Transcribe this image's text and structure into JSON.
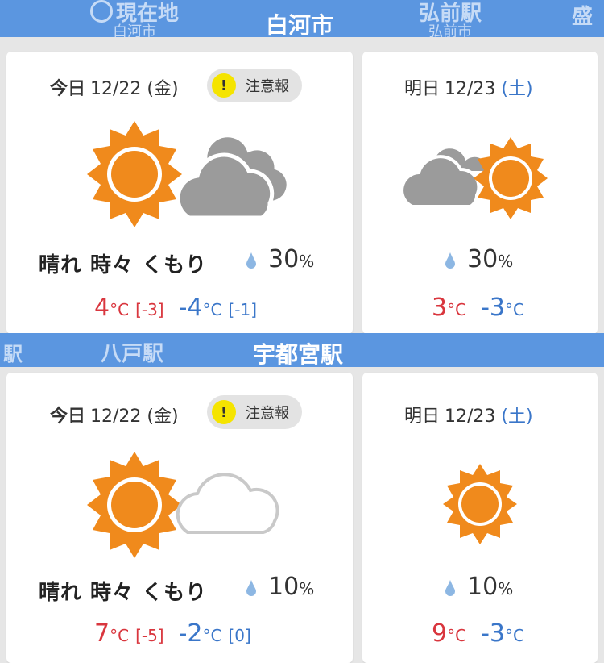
{
  "tabs_top": {
    "current_location_label": "現在地",
    "current_location_sub": "白河市",
    "active": "白河市",
    "right": "弘前駅",
    "right_sub": "弘前市",
    "far_right": "盛"
  },
  "tabs_mid": {
    "far_left": "駅",
    "left": "八戸駅",
    "active": "宇都宮駅"
  },
  "section1": {
    "today": {
      "day": "今日",
      "date": "12/22",
      "weekday": "(金)",
      "alert": "注意報",
      "alert_icon": "!",
      "weather": "晴れ 時々 くもり",
      "rain": "30",
      "rain_unit": "%",
      "high": "4",
      "high_unit": "°C",
      "high_diff": "[-3]",
      "low": "-4",
      "low_unit": "°C",
      "low_diff": "[-1]"
    },
    "tomorrow": {
      "day": "明日",
      "date": "12/23",
      "weekday": "(土)",
      "rain": "30",
      "rain_unit": "%",
      "high": "3",
      "high_unit": "°C",
      "low": "-3",
      "low_unit": "°C"
    }
  },
  "section2": {
    "today": {
      "day": "今日",
      "date": "12/22",
      "weekday": "(金)",
      "alert": "注意報",
      "alert_icon": "!",
      "weather": "晴れ 時々 くもり",
      "rain": "10",
      "rain_unit": "%",
      "high": "7",
      "high_unit": "°C",
      "high_diff": "[-5]",
      "low": "-2",
      "low_unit": "°C",
      "low_diff": "[0]"
    },
    "tomorrow": {
      "day": "明日",
      "date": "12/23",
      "weekday": "(土)",
      "rain": "10",
      "rain_unit": "%",
      "high": "9",
      "high_unit": "°C",
      "low": "-3",
      "low_unit": "°C"
    }
  },
  "colors": {
    "tab_bar": "#5b96e0",
    "high_temp": "#d9363e",
    "low_temp": "#3a76c9",
    "sun": "#f08a1c",
    "alert_dot": "#f5e400"
  }
}
